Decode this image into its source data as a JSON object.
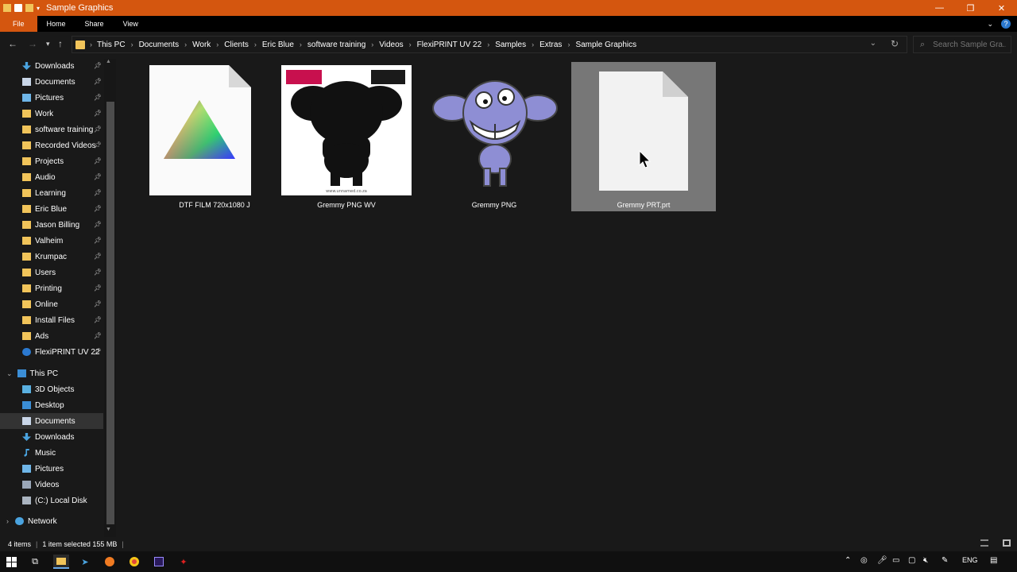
{
  "window": {
    "title": "Sample Graphics",
    "controls": {
      "minimize": "—",
      "restore": "❐",
      "close": "✕"
    }
  },
  "ribbon": {
    "tabs": [
      "File",
      "Home",
      "Share",
      "View"
    ],
    "collapse_glyph": "⌄",
    "help_glyph": "?"
  },
  "address": {
    "crumbs": [
      "This PC",
      "Documents",
      "Work",
      "Clients",
      "Eric Blue",
      "software training",
      "Videos",
      "FlexiPRINT UV 22",
      "Samples",
      "Extras",
      "Sample Graphics"
    ],
    "separator": "›"
  },
  "search": {
    "placeholder": "Search Sample Gra..."
  },
  "sidebar": {
    "quick_access": [
      {
        "label": "Downloads",
        "icon": "download-icon"
      },
      {
        "label": "Documents",
        "icon": "documents-icon"
      },
      {
        "label": "Pictures",
        "icon": "pictures-icon"
      },
      {
        "label": "Work",
        "icon": "folder-icon"
      },
      {
        "label": "software training",
        "icon": "folder-icon"
      },
      {
        "label": "Recorded Videos",
        "icon": "folder-icon"
      },
      {
        "label": "Projects",
        "icon": "folder-icon"
      },
      {
        "label": "Audio",
        "icon": "folder-icon"
      },
      {
        "label": "Learning",
        "icon": "folder-icon"
      },
      {
        "label": "Eric Blue",
        "icon": "folder-icon"
      },
      {
        "label": "Jason Billing",
        "icon": "folder-icon"
      },
      {
        "label": "Valheim",
        "icon": "folder-icon"
      },
      {
        "label": "Krumpac",
        "icon": "folder-icon"
      },
      {
        "label": "Users",
        "icon": "folder-icon"
      },
      {
        "label": "Printing",
        "icon": "folder-icon"
      },
      {
        "label": "Online",
        "icon": "folder-icon"
      },
      {
        "label": "Install Files",
        "icon": "folder-icon"
      },
      {
        "label": "Ads",
        "icon": "folder-icon"
      },
      {
        "label": "FlexiPRINT UV 22",
        "icon": "gear-icon"
      }
    ],
    "this_pc_label": "This PC",
    "this_pc_items": [
      {
        "label": "3D Objects",
        "icon": "3d-objects-icon"
      },
      {
        "label": "Desktop",
        "icon": "desktop-icon"
      },
      {
        "label": "Documents",
        "icon": "documents-icon",
        "selected": true
      },
      {
        "label": "Downloads",
        "icon": "download-icon"
      },
      {
        "label": "Music",
        "icon": "music-icon"
      },
      {
        "label": "Pictures",
        "icon": "pictures-icon"
      },
      {
        "label": "Videos",
        "icon": "videos-icon"
      },
      {
        "label": "(C:) Local Disk",
        "icon": "disk-icon"
      }
    ],
    "network_label": "Network",
    "colors": {
      "folder": "#f1c45a",
      "selected_bg": "#333333"
    }
  },
  "files": [
    {
      "name": "DTF FILM 720x1080 J",
      "thumb": "rgb-triangle"
    },
    {
      "name": "Gremmy PNG WV",
      "thumb": "silhouette"
    },
    {
      "name": "Gremmy PNG",
      "thumb": "monster"
    },
    {
      "name": "Gremmy PRT.prt",
      "thumb": "blank-document",
      "selected": true
    }
  ],
  "silhouette_caption": "www.unnamed.co.za",
  "status": {
    "items_count": "4 items",
    "selection": "1 item selected  155 MB"
  },
  "taskbar": {
    "language": "ENG",
    "colors": {
      "accent": "#d4560f",
      "background": "#101010"
    }
  }
}
